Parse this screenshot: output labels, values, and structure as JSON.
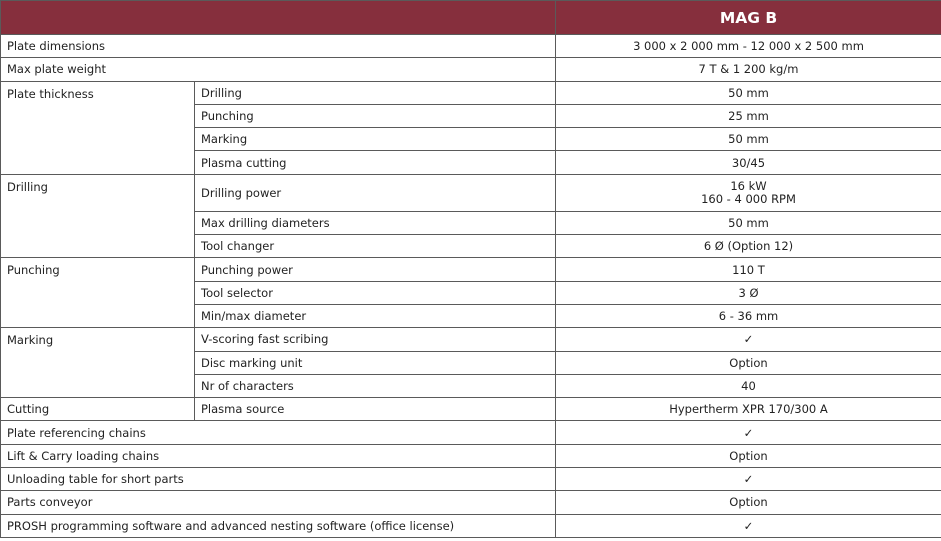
{
  "header": {
    "model": "MAG B"
  },
  "rows": {
    "plate_dimensions": {
      "label": "Plate dimensions",
      "value": "3 000 x 2 000 mm - 12 000 x 2 500 mm"
    },
    "max_plate_weight": {
      "label": "Max plate weight",
      "value": "7 T & 1 200 kg/m"
    },
    "plate_thickness": {
      "label": "Plate thickness",
      "items": [
        {
          "label": "Drilling",
          "value": "50 mm"
        },
        {
          "label": "Punching",
          "value": "25 mm"
        },
        {
          "label": "Marking",
          "value": "50 mm"
        },
        {
          "label": "Plasma cutting",
          "value": "30/45"
        }
      ]
    },
    "drilling": {
      "label": "Drilling",
      "items": [
        {
          "label": "Drilling power",
          "value_line1": "16 kW",
          "value_line2": "160 - 4 000 RPM"
        },
        {
          "label": "Max drilling diameters",
          "value": "50 mm"
        },
        {
          "label": "Tool changer",
          "value": "6 Ø (Option 12)"
        }
      ]
    },
    "punching": {
      "label": "Punching",
      "items": [
        {
          "label": "Punching power",
          "value": "110 T"
        },
        {
          "label": "Tool selector",
          "value": "3 Ø"
        },
        {
          "label": "Min/max diameter",
          "value": "6 - 36 mm"
        }
      ]
    },
    "marking": {
      "label": "Marking",
      "items": [
        {
          "label": "V-scoring fast scribing",
          "value": "✓"
        },
        {
          "label": "Disc marking unit",
          "value": "Option"
        },
        {
          "label": "Nr of characters",
          "value": "40"
        }
      ]
    },
    "cutting": {
      "label": "Cutting",
      "items": [
        {
          "label": "Plasma source",
          "value": "Hypertherm XPR 170/300 A"
        }
      ]
    },
    "plate_referencing_chains": {
      "label": "Plate referencing chains",
      "value": "✓"
    },
    "lift_carry": {
      "label": "Lift & Carry loading chains",
      "value": "Option"
    },
    "unloading_table": {
      "label": "Unloading table for short parts",
      "value": "✓"
    },
    "parts_conveyor": {
      "label": "Parts conveyor",
      "value": "Option"
    },
    "prosh": {
      "label": "PROSH programming software and advanced nesting software (office license)",
      "value": "✓"
    }
  }
}
